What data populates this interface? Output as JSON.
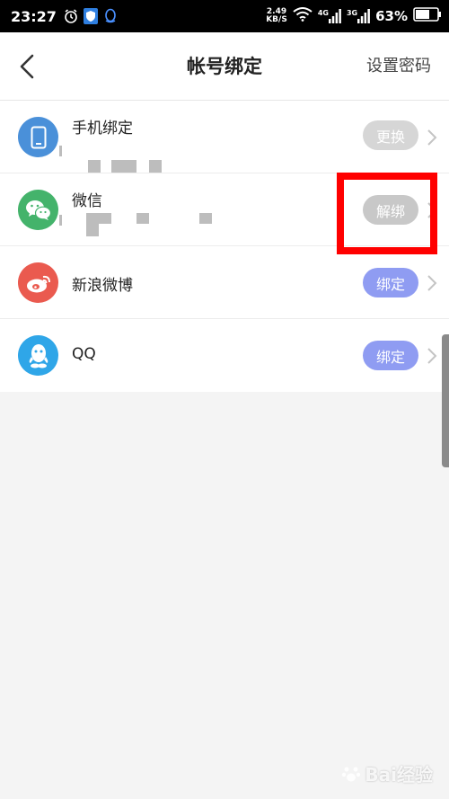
{
  "status_bar": {
    "time": "23:27",
    "net_speed_value": "2.49",
    "net_speed_unit": "KB/S",
    "signal_1_label": "4G",
    "signal_2_label": "3G",
    "battery_percent": "63%"
  },
  "header": {
    "title": "帐号绑定",
    "action_label": "设置密码"
  },
  "bindings": [
    {
      "name": "手机绑定",
      "button_label": "更换",
      "avatar_color": "#4a90d9",
      "icon": "phone-icon",
      "button_color": "#d6d6d6"
    },
    {
      "name": "微信",
      "button_label": "解绑",
      "avatar_color": "#44b36b",
      "icon": "wechat-icon",
      "button_color": "#c8c8c8"
    },
    {
      "name": "新浪微博",
      "button_label": "绑定",
      "avatar_color": "#ea5a4f",
      "icon": "weibo-icon",
      "button_color": "#8f9cf2"
    },
    {
      "name": "QQ",
      "button_label": "绑定",
      "avatar_color": "#2fa6e8",
      "icon": "qq-icon",
      "button_color": "#8f9cf2"
    }
  ],
  "highlight_color": "#ff0000",
  "watermark": "Bai经验"
}
